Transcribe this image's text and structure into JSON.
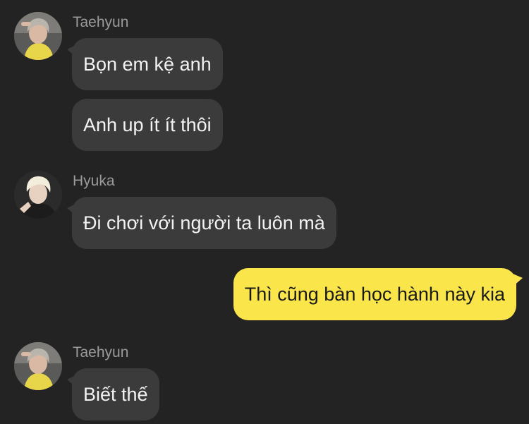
{
  "colors": {
    "background": "#232323",
    "incoming_bubble": "#3b3b3b",
    "outgoing_bubble": "#fae64b",
    "sender_name": "#9a9a9a"
  },
  "groups": [
    {
      "sender": "Taehyun",
      "avatar_icon": "profile-photo-icon",
      "messages": [
        "Bọn em kệ anh",
        "Anh up ít ít thôi"
      ]
    },
    {
      "sender": "Hyuka",
      "avatar_icon": "profile-photo-icon",
      "messages": [
        "Đi chơi với người ta luôn mà"
      ]
    },
    {
      "sender": "",
      "outgoing": true,
      "messages": [
        "Thì cũng bàn học hành này kia"
      ]
    },
    {
      "sender": "Taehyun",
      "avatar_icon": "profile-photo-icon",
      "messages": [
        "Biết thế"
      ]
    }
  ]
}
